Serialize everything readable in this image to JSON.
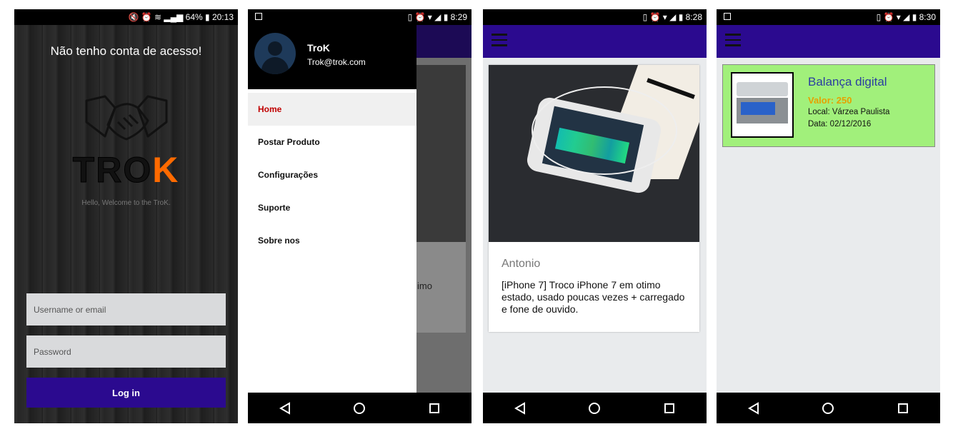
{
  "screen1": {
    "status": "🔇 ⏰ ≋ ▂▄▆ 64% ▮ 20:13",
    "title": "Não tenho conta de acesso!",
    "logo_prefix": "TRO",
    "logo_suffix": "K",
    "welcome": "Hello, Welcome to the TroK.",
    "username_placeholder": "Username or email",
    "password_placeholder": "Password",
    "login_label": "Log in"
  },
  "screen2": {
    "status": "▯ ⏰ ▾ ◢ ▮ 8:29",
    "user_name": "TroK",
    "user_email": "Trok@trok.com",
    "menu": [
      {
        "label": "Home"
      },
      {
        "label": "Postar Produto"
      },
      {
        "label": "Configurações"
      },
      {
        "label": "Suporte"
      },
      {
        "label": "Sobre nos"
      }
    ],
    "dim_text": "imo"
  },
  "screen3": {
    "status": "▯ ⏰ ▾ ◢ ▮ 8:28",
    "author": "Antonio",
    "description": "[iPhone 7] Troco iPhone 7 em otimo estado, usado poucas vezes + carregado e fone de ouvido."
  },
  "screen4": {
    "status": "▯ ⏰ ▾ ◢ ▮ 8:30",
    "product_title": "Balança digital",
    "value": "Valor: 250",
    "local": "Local: Várzea Paulista",
    "date": "Data: 02/12/2016"
  },
  "navbar": {
    "back_icon": "back-triangle-icon",
    "home_icon": "home-circle-icon",
    "recents_icon": "recents-square-icon"
  },
  "colors": {
    "appbar": "#2b0a8f",
    "logo_accent": "#ff6a00",
    "card_green": "#a1f07b",
    "active_menu": "#c00000"
  }
}
